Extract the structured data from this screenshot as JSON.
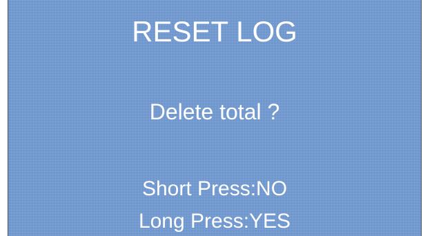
{
  "screen": {
    "title": "RESET LOG",
    "question": "Delete total ?",
    "short_press": "Short Press:NO",
    "long_press": "Long Press:YES"
  },
  "colors": {
    "background": "#6f97cd",
    "text": "#ffffff"
  }
}
